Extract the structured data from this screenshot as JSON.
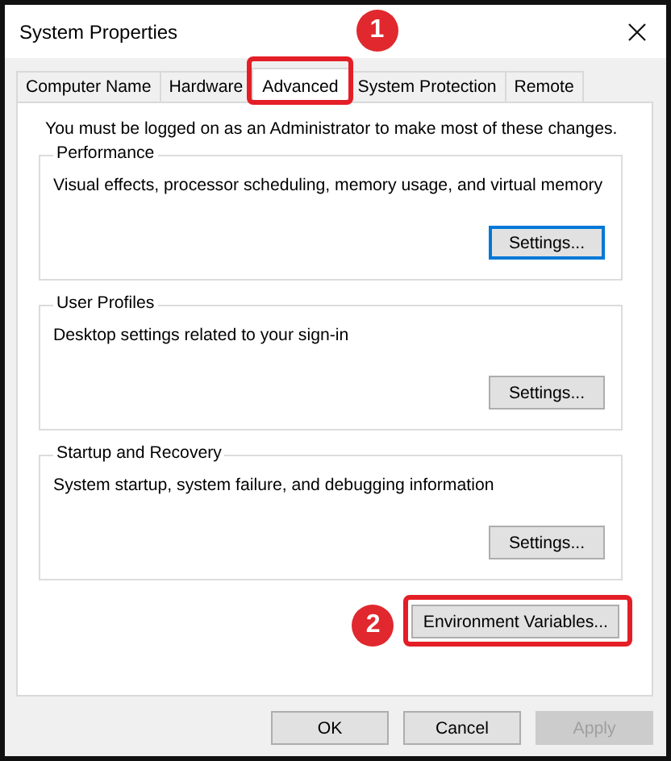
{
  "window": {
    "title": "System Properties"
  },
  "tabs": [
    {
      "label": "Computer Name",
      "selected": false
    },
    {
      "label": "Hardware",
      "selected": false
    },
    {
      "label": "Advanced",
      "selected": true,
      "annotation": "1"
    },
    {
      "label": "System Protection",
      "selected": false
    },
    {
      "label": "Remote",
      "selected": false
    }
  ],
  "notice": "You must be logged on as an Administrator to make most of these changes.",
  "groups": [
    {
      "title": "Performance",
      "description": "Visual effects, processor scheduling, memory usage, and virtual memory",
      "button": {
        "label": "Settings...",
        "focused": true
      }
    },
    {
      "title": "User Profiles",
      "description": "Desktop settings related to your sign-in",
      "button": {
        "label": "Settings...",
        "focused": false
      }
    },
    {
      "title": "Startup and Recovery",
      "description": "System startup, system failure, and debugging information",
      "button": {
        "label": "Settings...",
        "focused": false
      }
    }
  ],
  "environment_button": {
    "label": "Environment Variables...",
    "annotation": "2"
  },
  "buttons": [
    {
      "label": "OK",
      "disabled": false
    },
    {
      "label": "Cancel",
      "disabled": false
    },
    {
      "label": "Apply",
      "disabled": true
    }
  ]
}
